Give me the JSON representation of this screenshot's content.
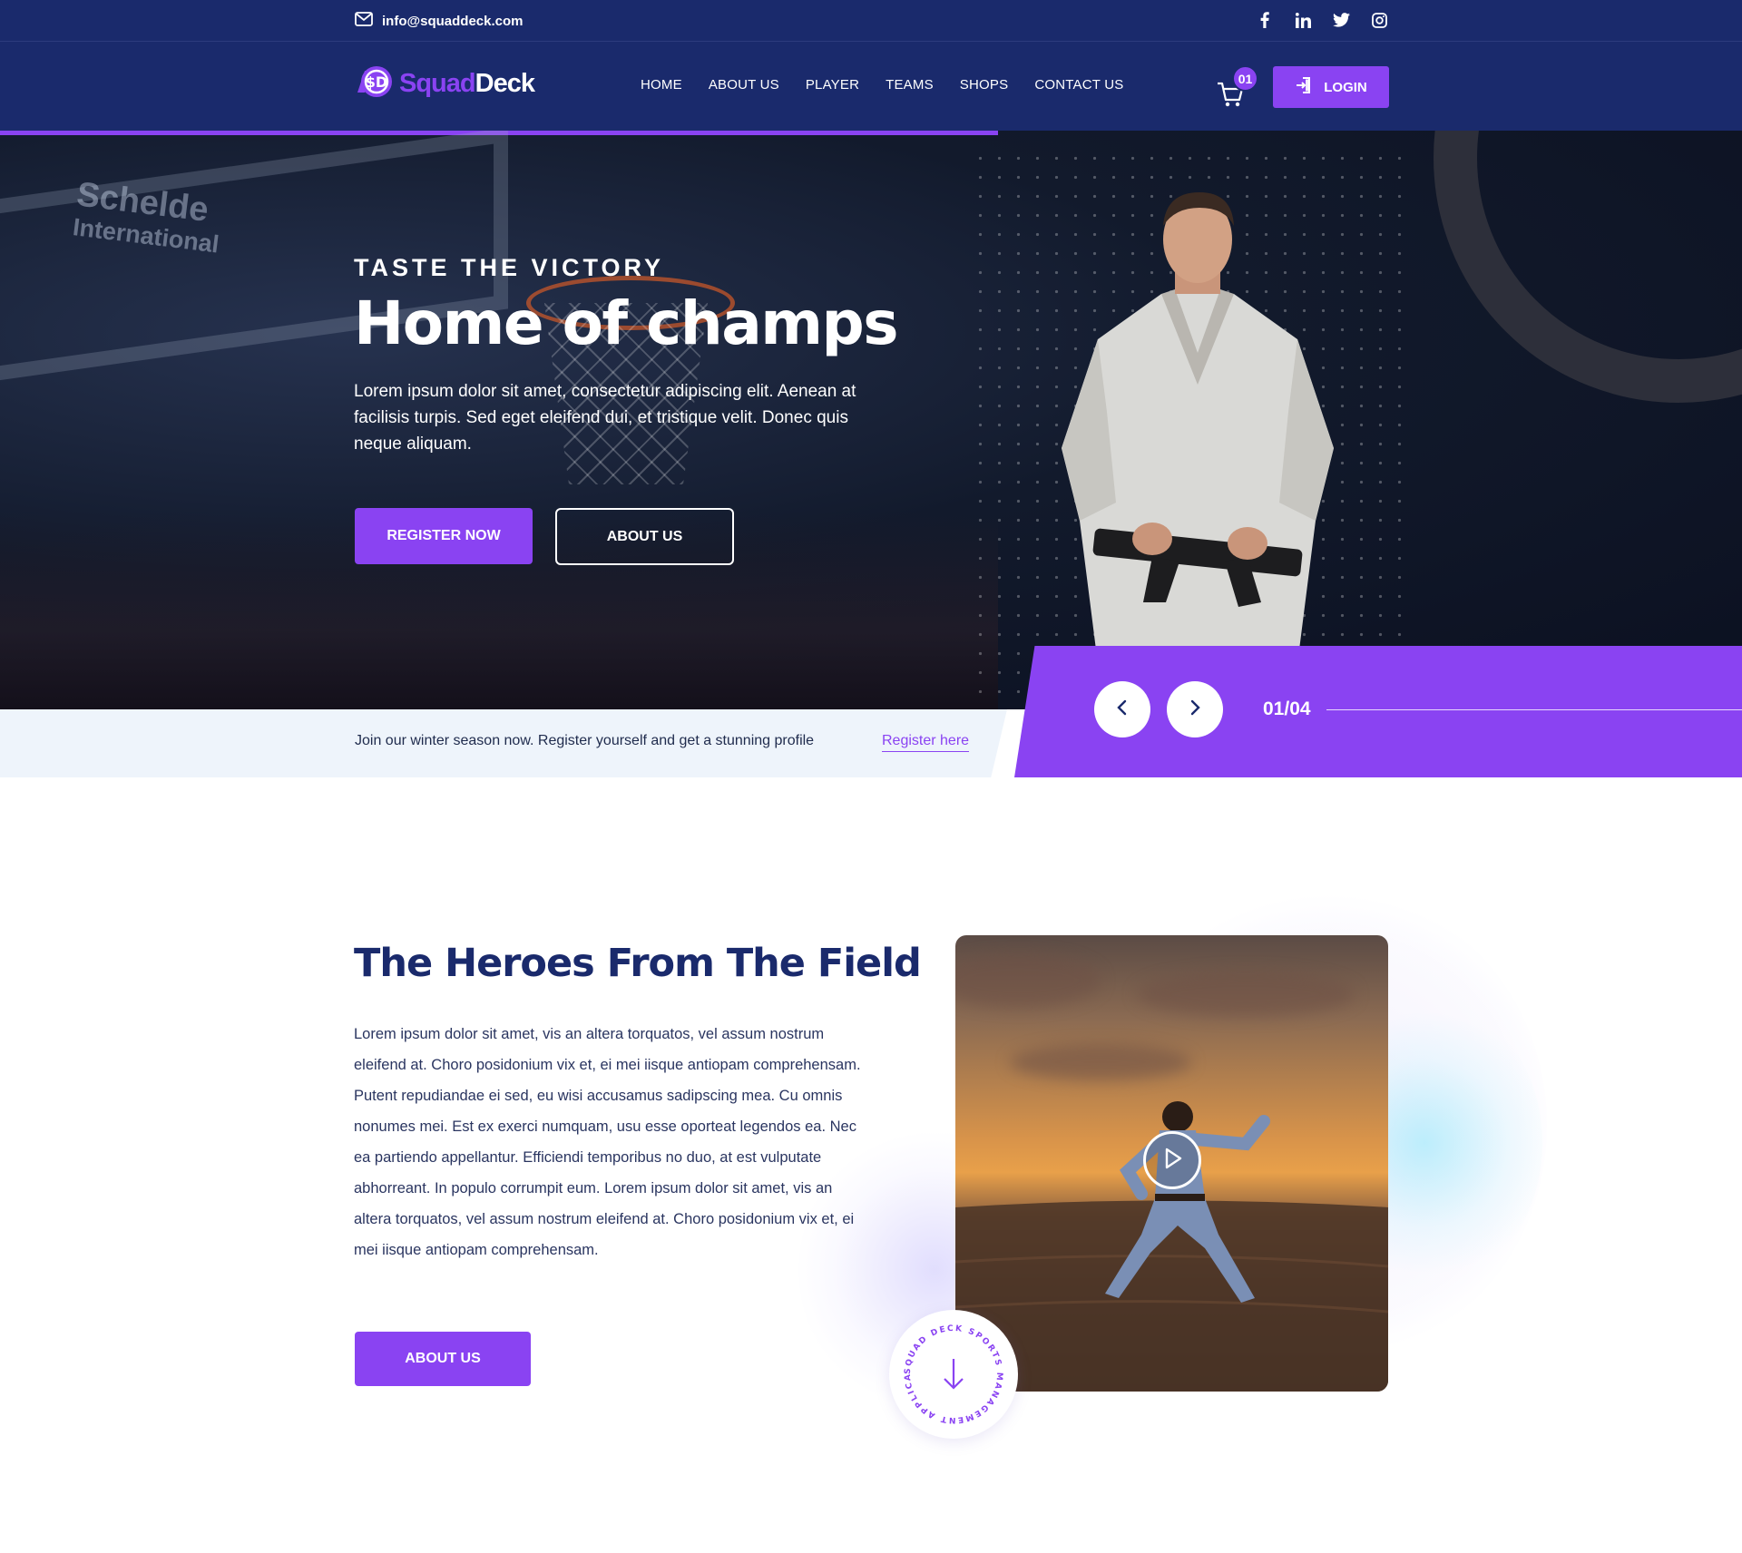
{
  "topbar": {
    "email": "info@squaddeck.com",
    "social_icons": [
      "facebook-icon",
      "linkedin-icon",
      "twitter-icon",
      "instagram-icon"
    ]
  },
  "header": {
    "logo_part1": "Squad",
    "logo_part2": "Deck",
    "nav": [
      "HOME",
      "ABOUT US",
      "PLAYER",
      "TEAMS",
      "SHOPS",
      "CONTACT US"
    ],
    "cart_count": "01",
    "login_label": "LOGIN"
  },
  "hero": {
    "eyebrow": "TASTE THE VICTORY",
    "title": "Home of champs",
    "description": "Lorem ipsum dolor sit amet, consectetur adipiscing elit. Aenean at facilisis turpis. Sed eget eleifend dui, et tristique velit. Donec quis neque aliquam.",
    "primary_button": "REGISTER NOW",
    "secondary_button": "ABOUT US",
    "background_text_1": "Schelde",
    "background_text_2": "International"
  },
  "announcement": {
    "message": "Join our winter season now. Register yourself and get a stunning profile",
    "link": "Register here"
  },
  "slider": {
    "counter": "01/04"
  },
  "about": {
    "title": "The Heroes From The Field",
    "body": "Lorem ipsum dolor sit amet, vis an altera torquatos, vel assum nostrum eleifend at. Choro posidonium vix et, ei mei iisque antiopam comprehensam. Putent repudiandae ei sed, eu wisi accusamus sadipscing mea. Cu omnis nonumes mei. Est ex exerci numquam, usu esse oporteat legendos ea. Nec ea partiendo appellantur. Efficiendi temporibus no duo, at est vulputate abhorreant. In populo corrumpit eum. Lorem ipsum dolor sit amet, vis an altera torquatos, vel assum nostrum eleifend at. Choro posidonium vix et, ei mei iisque antiopam comprehensam.",
    "button": "ABOUT US",
    "badge_text": "SQUAD DECK SPORTS MANAGEMENT APPLICATION"
  },
  "colors": {
    "navy": "#1a2a6c",
    "accent": "#8a43f2",
    "strip": "#eef4fb"
  }
}
